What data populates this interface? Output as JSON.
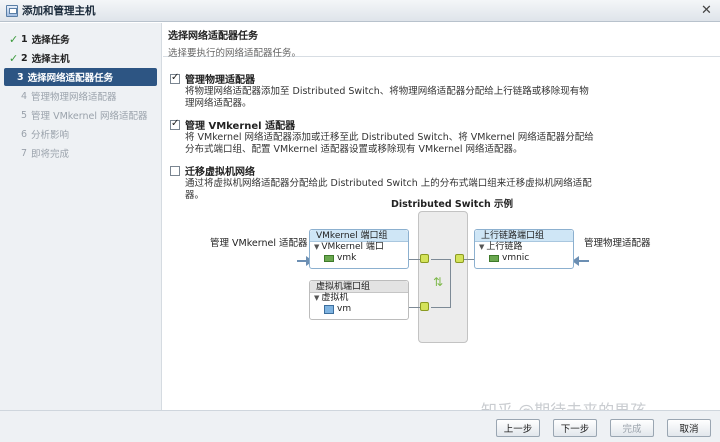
{
  "window": {
    "title": "添加和管理主机",
    "close_glyph": "✕"
  },
  "steps": [
    {
      "num": "1",
      "label": "选择任务",
      "state": "done"
    },
    {
      "num": "2",
      "label": "选择主机",
      "state": "done"
    },
    {
      "num": "3",
      "label": "选择网络适配器任务",
      "state": "active"
    },
    {
      "num": "4",
      "label": "管理物理网络适配器",
      "state": "pending"
    },
    {
      "num": "5",
      "label": "管理 VMkernel 网络适配器",
      "state": "pending"
    },
    {
      "num": "6",
      "label": "分析影响",
      "state": "pending"
    },
    {
      "num": "7",
      "label": "即将完成",
      "state": "pending"
    }
  ],
  "header": {
    "title": "选择网络适配器任务",
    "subtitle": "选择要执行的网络适配器任务。"
  },
  "options": [
    {
      "label": "管理物理适配器",
      "checked": true,
      "desc": "将物理网络适配器添加至 Distributed Switch、将物理网络适配器分配给上行链路或移除现有物理网络适配器。"
    },
    {
      "label": "管理 VMkernel 适配器",
      "checked": true,
      "desc": "将 VMkernel 网络适配器添加或迁移至此 Distributed Switch、将 VMkernel 网络适配器分配给分布式端口组、配置 VMkernel 适配器设置或移除现有 VMkernel 网络适配器。"
    },
    {
      "label": "迁移虚拟机网络",
      "checked": false,
      "desc": "通过将虚拟机网络适配器分配给此 Distributed Switch 上的分布式端口组来迁移虚拟机网络适配器。"
    }
  ],
  "diagram": {
    "title": "Distributed Switch 示例",
    "left_label": "管理 VMkernel 适配器",
    "right_label": "管理物理适配器",
    "vmk_group": {
      "header": "VMkernel 端口组",
      "sub": "VMkernel 端口",
      "item": "vmk"
    },
    "vm_group": {
      "header": "虚拟机端口组",
      "sub": "虚拟机",
      "item": "vm"
    },
    "uplink_group": {
      "header": "上行链路端口组",
      "sub": "上行链路",
      "item": "vmnic"
    }
  },
  "watermark": "知乎 @期待未来的男孩",
  "buttons": {
    "back": "上一步",
    "next": "下一步",
    "finish": "完成",
    "cancel": "取消"
  },
  "colors": {
    "active_step": "#2d5583",
    "group_header": "#cfe6f6",
    "check": "#3c9a3c"
  }
}
